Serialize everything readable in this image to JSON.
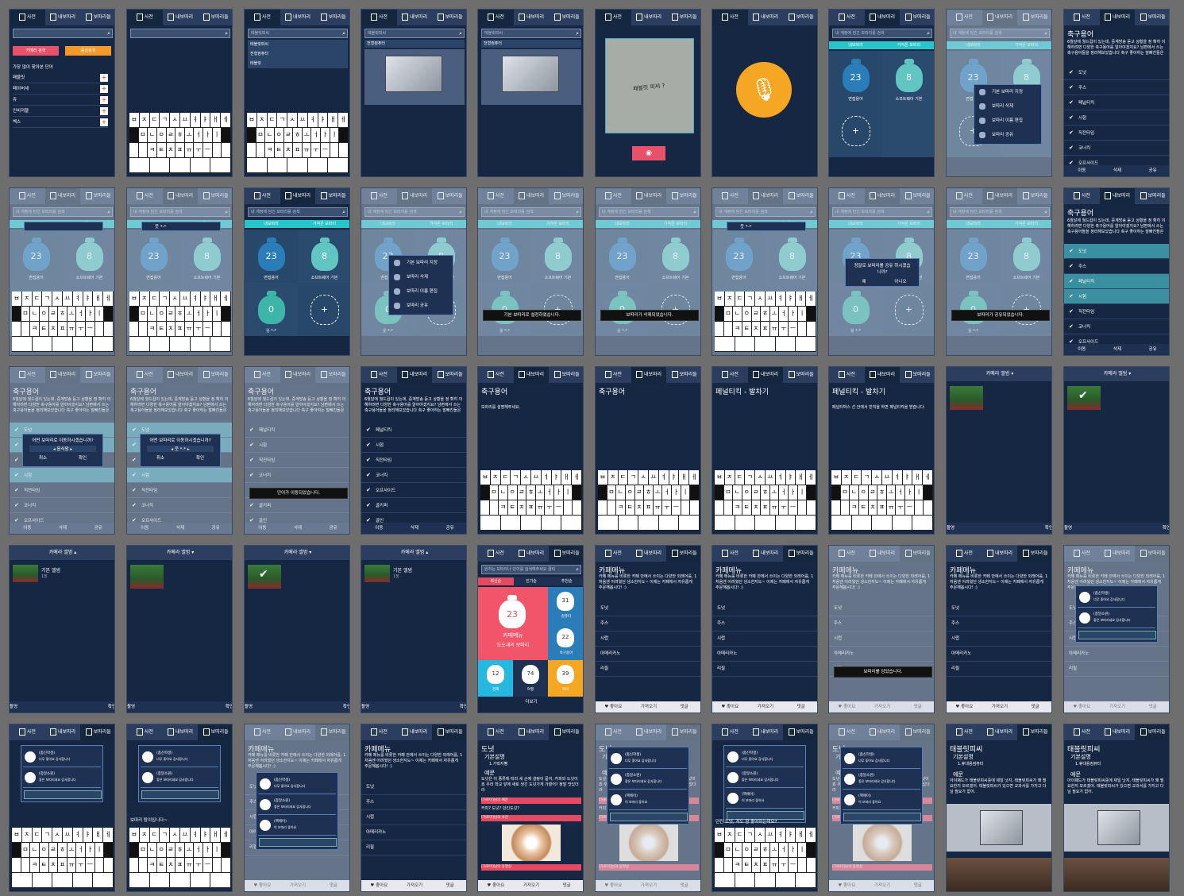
{
  "tabs": {
    "dict": "사전",
    "mybag": "내보따리",
    "bag": "보따리들"
  },
  "search_placeholder": "내 계정에 담긴 보따리를 검색",
  "search_placeholder2": "원하는 보따리나 단어를 검색해주세요 클릭",
  "screen1": {
    "btn_camera": "카메라 검색",
    "btn_voice": "음성검색",
    "heading": "가장 많이 찾아본 단어",
    "words": [
      "패블릿",
      "페이버세",
      "쥬",
      "인비져블",
      "벡스"
    ]
  },
  "keyboard": {
    "row1": [
      "ㅂ",
      "ㅈ",
      "ㄷ",
      "ㄱ",
      "ㅅ",
      "ㅛ",
      "ㅕ",
      "ㅑ",
      "ㅐ",
      "ㅔ"
    ],
    "row2": [
      "ㅁ",
      "ㄴ",
      "ㅇ",
      "ㄹ",
      "ㅎ",
      "ㅗ",
      "ㅓ",
      "ㅏ",
      "ㅣ"
    ],
    "row3": [
      "ㅋ",
      "ㅌ",
      "ㅊ",
      "ㅍ",
      "ㅠ",
      "ㅜ",
      "ㅡ"
    ]
  },
  "suggest": {
    "s1": "테블릿피씨",
    "s2": "전형컴퓨터",
    "s3": "테블릿"
  },
  "camera_text": "패블릿 피씨 ?",
  "subtabs": {
    "mine": "내보따리",
    "taken": "가져온 보따리"
  },
  "bags": {
    "b1": {
      "count": "23",
      "name": "면접용어"
    },
    "b2": {
      "count": "8",
      "name": "소프트웨어 기본"
    },
    "b3": {
      "count": "0",
      "name": "웃 *-*"
    }
  },
  "new_bag_name": "웃 *-*",
  "bag_menu": [
    "기본 보따리 지정",
    "보따리 삭제",
    "보따리 이름 편집",
    "보따리 공유"
  ],
  "toasts": {
    "set_default": "기본 보따리로 설정하였습니다.",
    "deleted": "보따리가 삭제되었습니다.",
    "shared": "보따리가 공유되었습니다.",
    "moved": "단어가 이동되었습니다.",
    "added": "보따리를 담았습니다."
  },
  "confirm_share": {
    "q": "정말로 보따리를 공유 하시겠습니까?",
    "yes": "예",
    "no": "아니오"
  },
  "move_dialog": {
    "q": "어떤 보따리로 이동하시겠습니까?",
    "target": "음식왕",
    "cancel": "취소",
    "ok": "확인"
  },
  "move_dialog2": {
    "target": "웃 *-*"
  },
  "soccer": {
    "title": "축구용어",
    "desc": "6월달에 월드컵이 있는데, 중계방송 듣고 상황을 정 확히 이해하려면 다양한 축구용어를 알아야겠지요? 남편에서 쓰는 축구용어들을 정리해보았습니다 축구 좋아하는 말빠친들은",
    "words": [
      "도넛",
      "주스",
      "페널티킥",
      "시험",
      "직전타임",
      "코너킥",
      "오프사이드",
      "골키퍼",
      "골인",
      "오버헤드킥"
    ],
    "edit_placeholder": "보따리를 설명해주세요."
  },
  "bottom": {
    "move": "이동",
    "delete": "삭제",
    "share": "공유"
  },
  "penalty": {
    "title": "페널티킥 - 발차기",
    "desc": "페널티박스 선 안에서 반칙을 하면 페널티킥을 받습니다."
  },
  "album": {
    "title": "카메라 앨범",
    "shoot": "촬영",
    "confirm": "확인",
    "default_album": "기본 앨범",
    "default_count": "1장"
  },
  "explore": {
    "tabs": [
      "최신순",
      "인기순",
      "추천순"
    ],
    "big": {
      "count": "23",
      "name": "카페메뉴",
      "owner": "도도새의 보따리"
    },
    "small": [
      {
        "count": "31",
        "name": "컴퓨터"
      },
      {
        "count": "22",
        "name": "축구용어"
      },
      {
        "count": "12",
        "name": "경제"
      },
      {
        "count": "74",
        "name": "여행"
      },
      {
        "count": "39",
        "name": "자바"
      }
    ],
    "more": "더보기"
  },
  "cafe": {
    "title": "카페메뉴",
    "desc": "카페 메뉴를 비롯한 카페 안에서 쓰이는 다양한 외래어를, 1 처음엔 어려웠던 생소한지도~ 이제는 카페에서 자유롭게 주문해봅시다! :)",
    "words": [
      "도넛",
      "주스",
      "시럽",
      "아메리카노",
      "리필"
    ]
  },
  "social": {
    "like": "좋아요",
    "take": "가져오기",
    "comment": "댓글"
  },
  "comments": [
    {
      "user": "(춤신학생)",
      "text": "너무 좋아요 감사합니다"
    },
    {
      "user": "(종달소원)",
      "text": "좋은 보따리네요 감사합니다"
    },
    {
      "user": "(핵에이)",
      "text": "이 보따리 좋아요"
    }
  ],
  "comment_typed": "보따리 탐이입니다~",
  "donut": {
    "title": "도넛",
    "basic": "기본설명",
    "basic_text": "1.가락지빵",
    "ex": "예문",
    "ex_text": "도넛은 이 종류에 따라 세 손에 설탕이 묻어, 커피와 도넛이죠 우리 학교 앞에 새로 생긴 도넛가게 가봤어? 정말 맛있더라",
    "bubble1": "[가로미]님의 예문",
    "bubble1_text": "커피? 도넛? 던킨도넛?",
    "bubble2": "[가로미]님의 사진",
    "bubble3": "[가로미]님의 동영상",
    "typed": "던킨 도넛, 저도 참 좋아하는데요?"
  },
  "tablet": {
    "title": "태블릿피씨",
    "basic": "기본설명",
    "basic_text": "1.휴대용컴퓨터",
    "ex": "예문",
    "ex_text": "아이패드가 태블릿피씨중에 제일 낫지, 태블릿피씨가 왜 필요한지 모르겠어. 태블릿피씨가 있으면 교과서를 가지고 다닐 필요가 없어."
  }
}
